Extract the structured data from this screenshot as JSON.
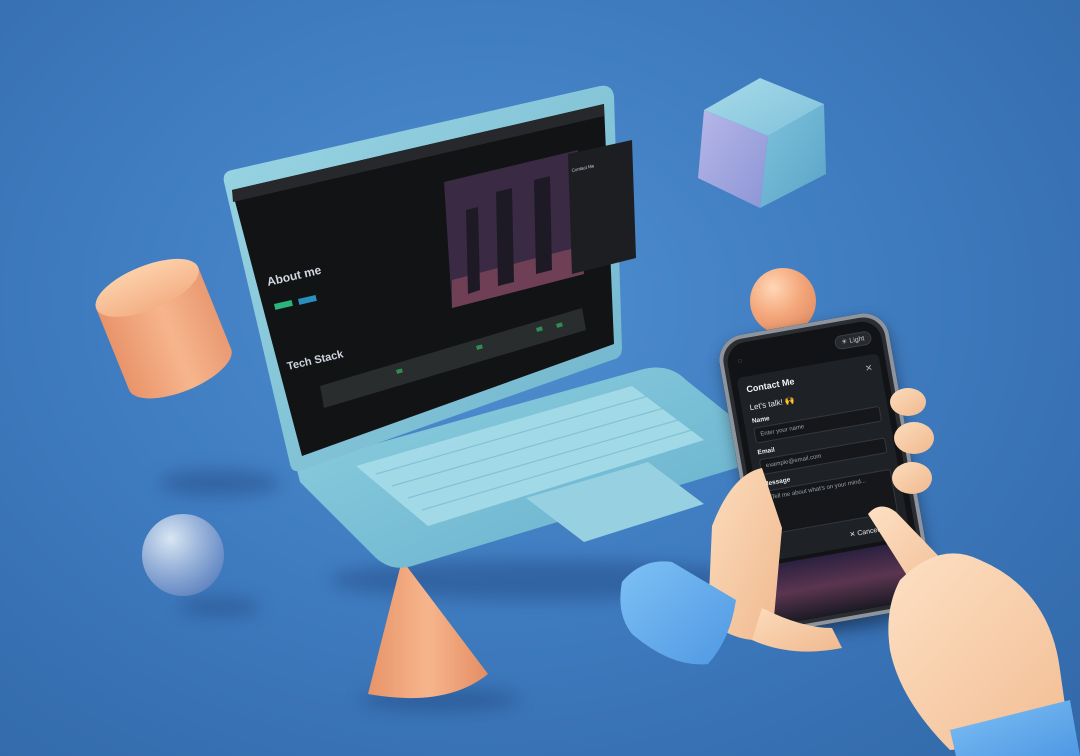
{
  "scene": {
    "background_color": "#3f7cc0",
    "objects": [
      "cylinder",
      "sphere",
      "cone",
      "cube",
      "sphere",
      "laptop",
      "phone",
      "hands"
    ]
  },
  "laptop_screen": {
    "about_heading": "About me",
    "tech_stack_heading": "Tech Stack",
    "contact_panel_title": "Contact Me",
    "colors": {
      "bg": "#121315",
      "accent": "#2bb57c",
      "banner_sky": "#6e3f55"
    }
  },
  "phone_screen": {
    "theme_button": "Light",
    "modal_title": "Contact Me",
    "greeting": "Let's talk! 🙌",
    "name_label": "Name",
    "name_placeholder": "Enter your name",
    "email_label": "Email",
    "email_placeholder": "example@email.com",
    "message_label": "Message",
    "message_placeholder": "Tell me about what's on your mind...",
    "cancel_label": "Cancel",
    "close_icon": "close-icon",
    "colors": {
      "modal_bg": "#1e2125",
      "send_button": "#2bc48a"
    }
  }
}
